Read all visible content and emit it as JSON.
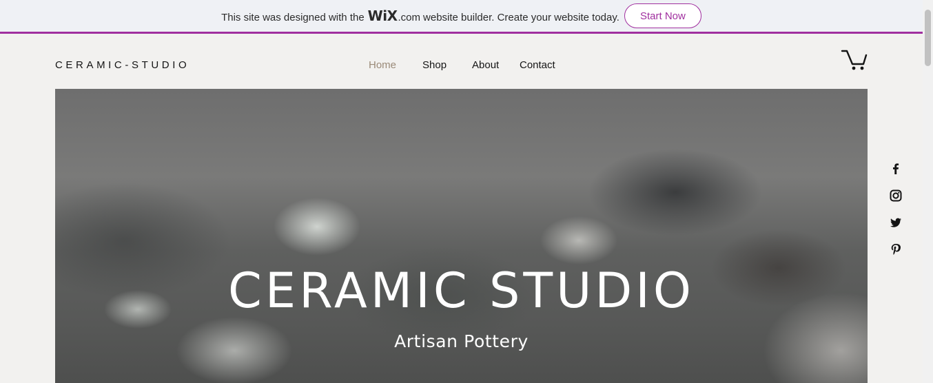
{
  "wix_banner": {
    "text_before": "This site was designed with the",
    "logo": "WiX",
    "logo_suffix": ".com",
    "text_after": "website builder. Create your website today.",
    "cta": "Start Now",
    "accent_color": "#a02f9f"
  },
  "header": {
    "logo": "CERAMIC-STUDIO",
    "nav": [
      {
        "label": "Home",
        "active": true
      },
      {
        "label": "Shop",
        "active": false
      },
      {
        "label": "About",
        "active": false
      },
      {
        "label": "Contact",
        "active": false
      }
    ],
    "cart_icon": "cart-icon"
  },
  "hero": {
    "title": "CERAMIC STUDIO",
    "subtitle": "Artisan Pottery"
  },
  "social": [
    {
      "icon": "facebook-icon"
    },
    {
      "icon": "instagram-icon"
    },
    {
      "icon": "twitter-icon"
    },
    {
      "icon": "pinterest-icon"
    }
  ],
  "colors": {
    "page_background": "#f2f1ef",
    "nav_active": "#9a8a78",
    "text": "#141414"
  }
}
